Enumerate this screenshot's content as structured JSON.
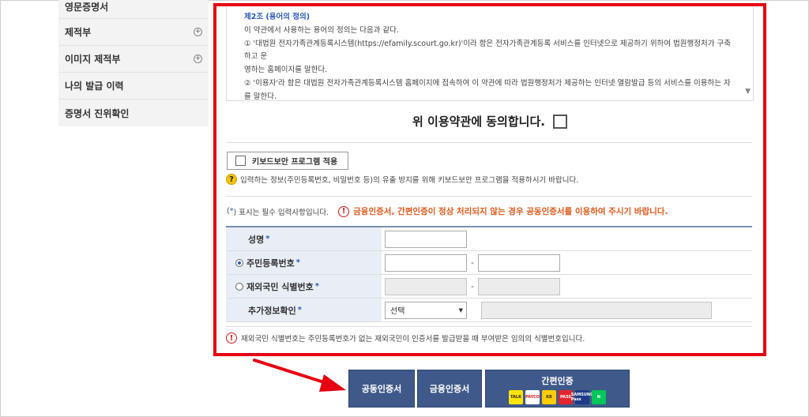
{
  "sidebar": {
    "items": [
      {
        "label": "영문증명서",
        "expandable": false
      },
      {
        "label": "제적부",
        "expandable": true
      },
      {
        "label": "이미지 제적부",
        "expandable": true
      },
      {
        "label": "나의 발급 이력",
        "expandable": false
      },
      {
        "label": "증명서 진위확인",
        "expandable": false
      }
    ],
    "plus_symbol": "+"
  },
  "terms": {
    "article_title": "제2조 (용어의 정의)",
    "lines": [
      "이 약관에서 사용하는 용어의 정의는 다음과 같다.",
      "① '대법원 전자가족관계등록시스템(https://efamily.scourt.go.kr)'이라 함은 전자가족관계등록 서비스를 인터넷으로 제공하기 위하여 법원행정처가 구축하고 운",
      "영하는 홈페이지를 말한다.",
      "② '이용자'라 함은 대법원 전자가족관계등록시스템 홈페이지에 접속하여 이 약관에 따라 법원행정처가 제공하는 인터넷 열람발급 등의 서비스를 이용하는 자",
      "를 말한다."
    ],
    "scroll_arrow": "▼"
  },
  "agree": {
    "label": "위 이용약관에 동의합니다."
  },
  "keyboard": {
    "button_label": "키보드보안 프로그램 적용",
    "note": "입력하는 정보(주민등록번호, 비밀번호 등)의 유출 방지를 위해 키보드보안 프로그램을 적용하시기 바랍니다.",
    "icon_glyph": "?"
  },
  "required_note": {
    "prefix": "(",
    "star": "*",
    "text": ") 표시는 필수 입력사항입니다.",
    "warning": "금융인증서, 간편인증이 정상 처리되지 않는 경우 공동인증서를 이용하여 주시기 바랍니다.",
    "warn_glyph": "!"
  },
  "form": {
    "star": "*",
    "name_label": "성명",
    "rrn_label": "주민등록번호",
    "foreign_label": "재외국민 식별번호",
    "extra_label": "추가정보확인",
    "dash": "-",
    "select_value": "선택",
    "select_caret": "▼"
  },
  "foot_note": "재외국민 식별번호는 주민등록번호가 없는 재외국민이 인증서를 발급받을 때 부여받은 임의의 식별번호입니다.",
  "buttons": {
    "joint_cert": "공동인증서",
    "finance_cert": "금융인증서",
    "simple_auth": "간편인증",
    "logos": [
      {
        "name": "kakao",
        "text": "TALK",
        "bg": "#fee500",
        "fg": "#3a1d1d"
      },
      {
        "name": "payco",
        "text": "PAYCO",
        "bg": "#ffffff",
        "fg": "#e02020"
      },
      {
        "name": "kb",
        "text": "KB",
        "bg": "#ffcc00",
        "fg": "#333333"
      },
      {
        "name": "pass",
        "text": "PASS",
        "bg": "#e3262e",
        "fg": "#ffffff"
      },
      {
        "name": "samsung",
        "text": "SAMSUNG Pass",
        "bg": "#1f3c88",
        "fg": "#ffffff"
      },
      {
        "name": "naver",
        "text": "N",
        "bg": "#03c75a",
        "fg": "#ffffff"
      }
    ]
  },
  "colors": {
    "highlight": "#e60012",
    "button": "#3f5a8a",
    "warning": "#e2581b"
  }
}
